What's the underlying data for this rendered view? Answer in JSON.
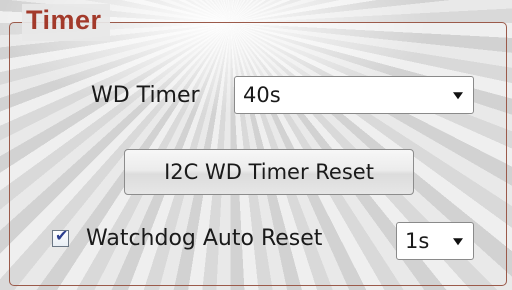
{
  "timer_group": {
    "title": "Timer",
    "wd_timer": {
      "label": "WD Timer",
      "selected": "40s"
    },
    "reset_button_label": "I2C WD Timer Reset",
    "auto_reset": {
      "checked": true,
      "label": "Watchdog Auto Reset",
      "interval_selected": "1s"
    }
  },
  "colors": {
    "group_title": "#a33a2b",
    "group_border": "#9b5a4a",
    "checkmark": "#2c3e8f"
  },
  "icons": {
    "dropdown": "dropdown-arrow-icon",
    "checkmark": "checkmark-icon"
  }
}
